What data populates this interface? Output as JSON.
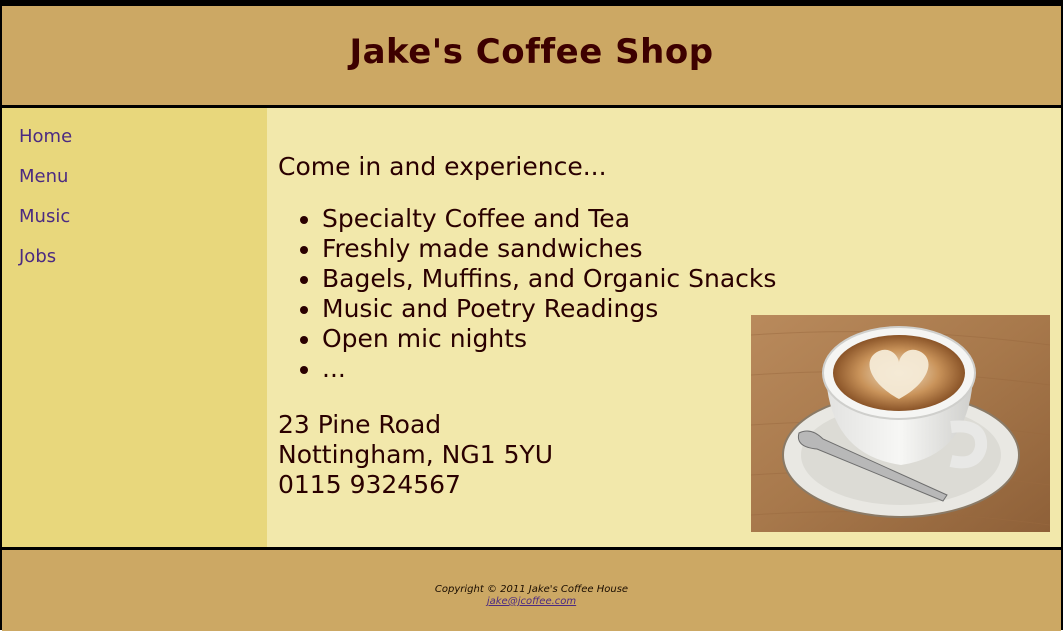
{
  "header": {
    "title": "Jake's Coffee Shop"
  },
  "nav": {
    "items": [
      {
        "label": "Home"
      },
      {
        "label": "Menu"
      },
      {
        "label": "Music"
      },
      {
        "label": "Jobs"
      }
    ]
  },
  "main": {
    "intro": "Come in and experience...",
    "features": [
      "Specialty Coffee and Tea",
      "Freshly made sandwiches",
      "Bagels, Muffins, and Organic Snacks",
      "Music and Poetry Readings",
      "Open mic nights",
      "..."
    ],
    "address": {
      "street": "23 Pine Road",
      "city": "Nottingham, NG1 5YU",
      "phone": "0115 9324567"
    }
  },
  "footer": {
    "copyright": "Copyright © 2011 Jake's Coffee House",
    "email": "jake@jcoffee.com"
  },
  "colors": {
    "header_bg": "#cca864",
    "sidebar_bg": "#e8d77c",
    "content_bg": "#f2e8ab",
    "title_color": "#3d0000",
    "link_color": "#4b2a82"
  }
}
